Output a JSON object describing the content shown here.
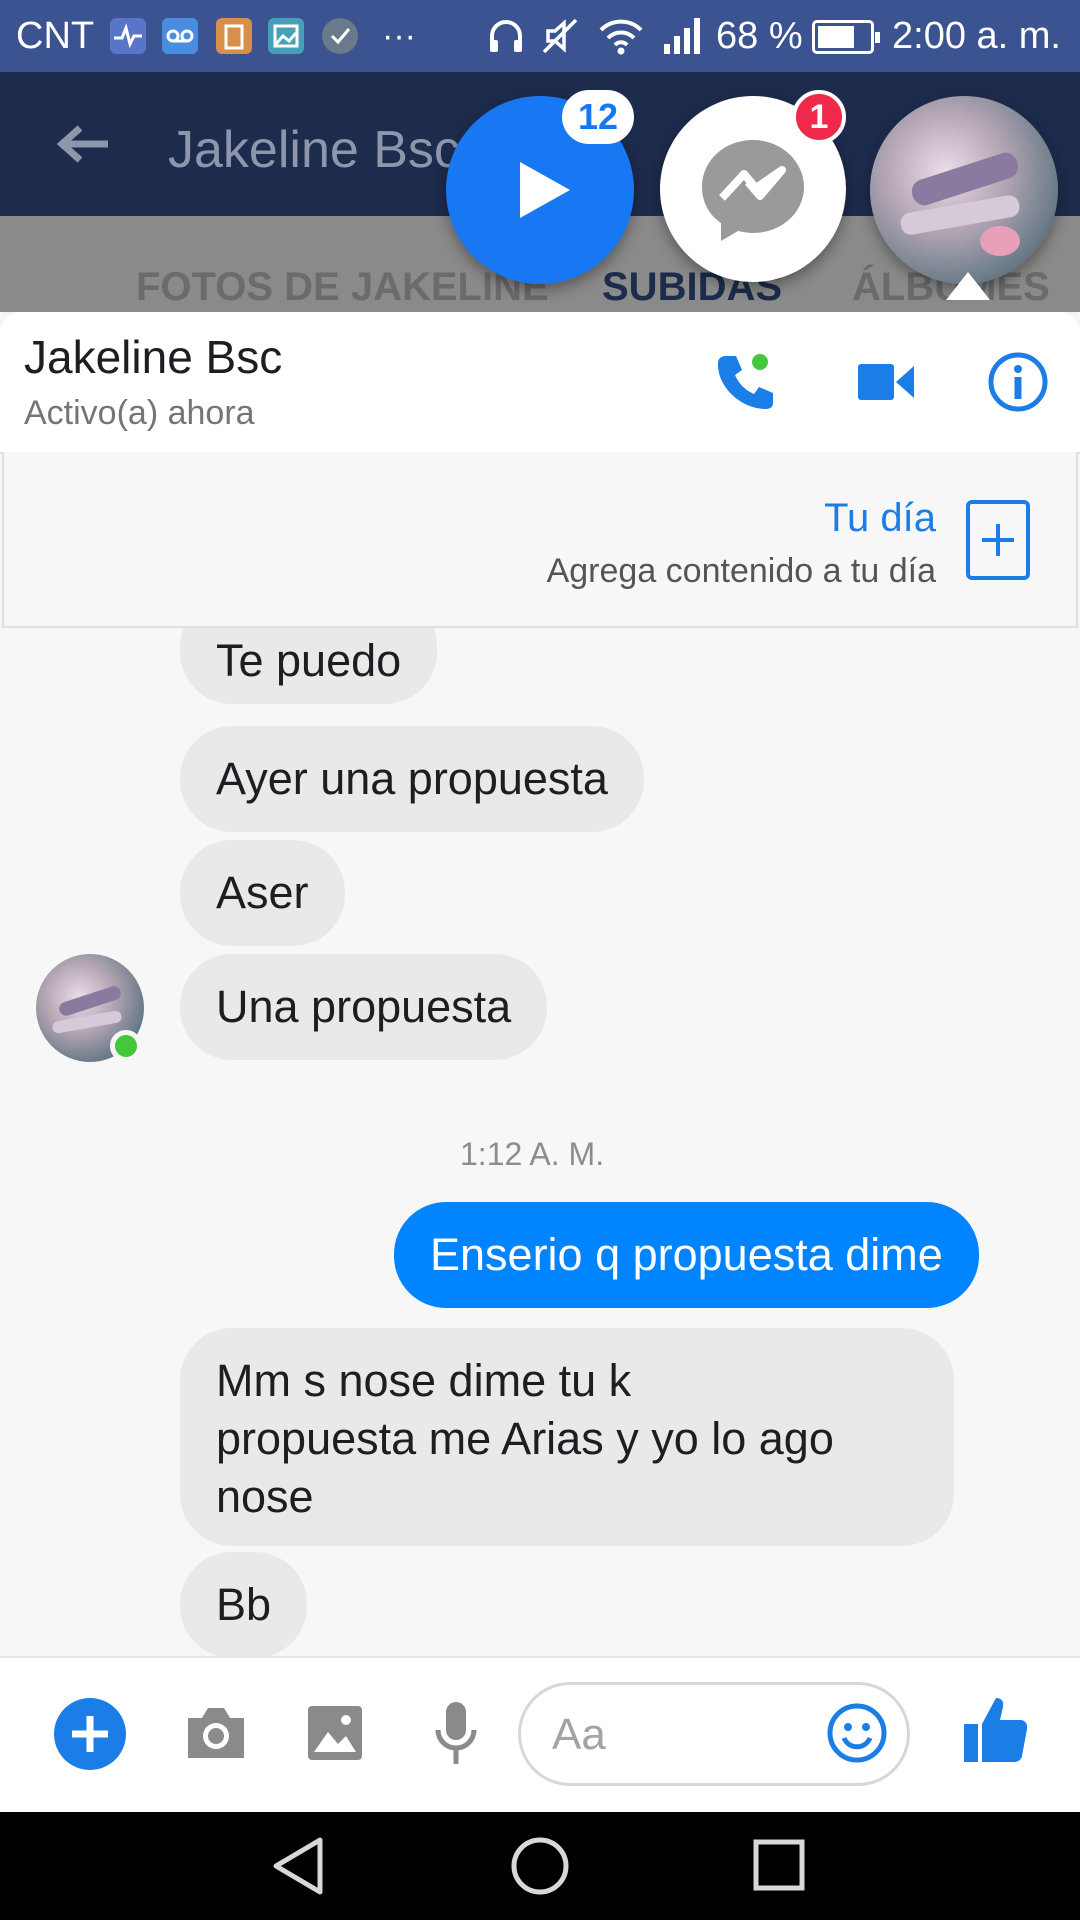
{
  "status_bar": {
    "carrier": "CNT",
    "overflow": "···",
    "battery": "68 %",
    "time": "2:00 a. m."
  },
  "background_page": {
    "title": "Jakeline Bsc",
    "tabs": [
      "FOTOS DE JAKELINE",
      "SUBIDAS",
      "ÁLBUMES"
    ],
    "active_tab": "SUBIDAS"
  },
  "chat_heads": {
    "video_badge": "12",
    "messenger_badge": "1"
  },
  "chat": {
    "contact_name": "Jakeline Bsc",
    "contact_status": "Activo(a) ahora"
  },
  "story": {
    "title": "Tu día",
    "subtitle": "Agrega contenido a tu día"
  },
  "messages": {
    "incoming_group_1": [
      "Te puedo",
      "Ayer una propuesta",
      "Aser",
      "Una propuesta"
    ],
    "timestamp": "1:12 A. M.",
    "outgoing": "Enserio q propuesta dime",
    "incoming_group_2": [
      "Mm s nose   dime tu  k",
      "propuesta  me Arias y yo lo ago",
      "nose",
      "Bb"
    ]
  },
  "composer": {
    "placeholder": "Aa"
  },
  "colors": {
    "messenger_blue": "#0084ff",
    "accent_blue": "#1a7ee6",
    "status_bar": "#3b5390",
    "online_green": "#44c73b",
    "badge_red": "#f02849"
  },
  "icons": [
    "back-arrow-icon",
    "play-icon",
    "messenger-icon",
    "phone-icon",
    "video-camera-icon",
    "info-icon",
    "plus-icon",
    "camera-icon",
    "gallery-icon",
    "microphone-icon",
    "emoji-icon",
    "thumbs-up-icon"
  ]
}
